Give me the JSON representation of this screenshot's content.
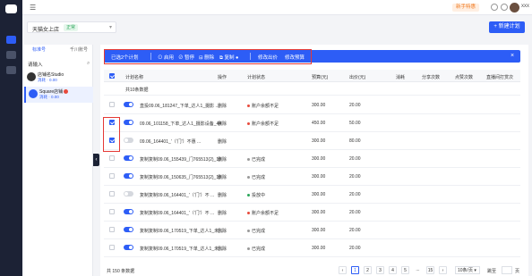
{
  "topbar": {
    "user_name": "xxx",
    "coupon_label": "新手特惠"
  },
  "account_selector": {
    "value": "天猫女上店",
    "badge": "正常"
  },
  "new_plan_button": "+ 新建计划",
  "left_panel": {
    "tabs": [
      "标准号",
      "千川账号"
    ],
    "search_label": "请输入",
    "accounts": [
      {
        "name": "店铺名Studio",
        "status": "消耗 · 0.00"
      },
      {
        "name": "Square店铺",
        "status": "消耗 · 0.00"
      }
    ]
  },
  "bulk_bar": {
    "selected": "已选2个计划",
    "actions": [
      "启用",
      "暂停",
      "删除",
      "复制",
      "修改出价",
      "修改预算"
    ]
  },
  "table": {
    "headers": [
      "计划名称",
      "操作",
      "计划状态",
      "预算(元)",
      "出价(元)",
      "消耗",
      "分享次数",
      "点赞次数",
      "直播间打赏次"
    ],
    "summary_label": "共10条数据",
    "rows": [
      {
        "name": "直投09.06_181247_下单_达人1_摄影 ...",
        "op": "删除",
        "status": "账户余额不足",
        "status_color": "#e84a3c",
        "budget": "300.00",
        "bid": "20.00",
        "checked": false,
        "on": true
      },
      {
        "name": "09.06_101158_下单_达人1_摄影设备_44",
        "op": "删除",
        "status": "账户余额不足",
        "status_color": "#e84a3c",
        "budget": "450.00",
        "bid": "50.00",
        "checked": true,
        "on": true
      },
      {
        "name": "09.06_164401_'（'门'）不惠 ...",
        "op": "删除",
        "status": "",
        "status_color": "#999999",
        "budget": "300.00",
        "bid": "80.00",
        "checked": true,
        "on": false
      },
      {
        "name": "复制复制09.06_155439_门765513(2)_10",
        "op": "删除",
        "status": "已完成",
        "status_color": "#999999",
        "budget": "300.00",
        "bid": "20.00",
        "checked": false,
        "on": true
      },
      {
        "name": "复制复制09.06_150635_门765513(2)_10",
        "op": "删除",
        "status": "已完成",
        "status_color": "#999999",
        "budget": "300.00",
        "bid": "20.00",
        "checked": false,
        "on": true
      },
      {
        "name": "复制复制09.06_164401_'（'门'）不 ...",
        "op": "删除",
        "status": "投放中",
        "status_color": "#2aa55a",
        "budget": "300.00",
        "bid": "20.00",
        "checked": false,
        "on": false
      },
      {
        "name": "复制复制09.06_164401_'（'门'）不 ...",
        "op": "删除",
        "status": "账户余额不足",
        "status_color": "#e84a3c",
        "budget": "300.00",
        "bid": "20.00",
        "checked": false,
        "on": true
      },
      {
        "name": "复制复制09.06_170519_下单_达人1_未 ...",
        "op": "删除",
        "status": "已完成",
        "status_color": "#999999",
        "budget": "300.00",
        "bid": "20.00",
        "checked": false,
        "on": true
      },
      {
        "name": "复制复制09.06_170519_下单_达人1_未 ...",
        "op": "删除",
        "status": "已完成",
        "status_color": "#999999",
        "budget": "300.00",
        "bid": "20.00",
        "checked": false,
        "on": true
      }
    ]
  },
  "footer": {
    "total": "共 150 条数据",
    "pages": [
      "1",
      "2",
      "3",
      "4",
      "5",
      "...",
      "15"
    ],
    "page_size": "10条/页",
    "goto_label": "跳至",
    "goto_suffix": "页"
  },
  "colors": {
    "accent": "#2d5df6",
    "sidebar": "#1c2235",
    "highlight": "#e53935"
  }
}
